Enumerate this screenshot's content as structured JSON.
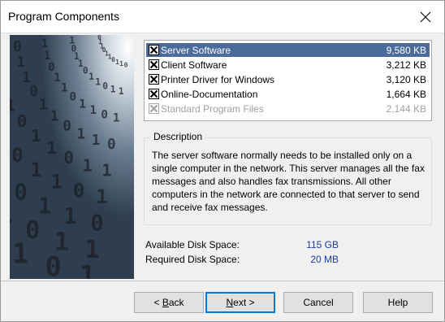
{
  "window": {
    "title": "Program Components",
    "close_icon": "close-icon"
  },
  "components": [
    {
      "name": "Server Software",
      "size": "9,580 KB",
      "checked": true,
      "selected": true,
      "disabled": false
    },
    {
      "name": "Client Software",
      "size": "3,212 KB",
      "checked": true,
      "selected": false,
      "disabled": false
    },
    {
      "name": "Printer Driver for Windows",
      "size": "3,120 KB",
      "checked": true,
      "selected": false,
      "disabled": false
    },
    {
      "name": "Online-Documentation",
      "size": "1,664 KB",
      "checked": true,
      "selected": false,
      "disabled": false
    },
    {
      "name": "Standard Program Files",
      "size": "2,144 KB",
      "checked": true,
      "selected": false,
      "disabled": true
    }
  ],
  "description": {
    "legend": "Description",
    "text": "The server software normally needs to be installed only on a single computer in the network. This server manages all the fax messages and also handles fax transmissions. All other computers in the network are connected to that server to send and receive fax messages."
  },
  "disk": {
    "available_label": "Available Disk Space:",
    "available_value": "115 GB",
    "required_label": "Required Disk Space:",
    "required_value": "20 MB"
  },
  "buttons": {
    "back": {
      "prefix": "< ",
      "mnemonic": "B",
      "rest": "ack"
    },
    "next": {
      "prefix": "",
      "mnemonic": "N",
      "rest": "ext >"
    },
    "cancel": "Cancel",
    "help": "Help"
  },
  "colors": {
    "selection": "#4a6b9c",
    "value_text": "#1b3d9e",
    "default_button_border": "#0078d7"
  }
}
